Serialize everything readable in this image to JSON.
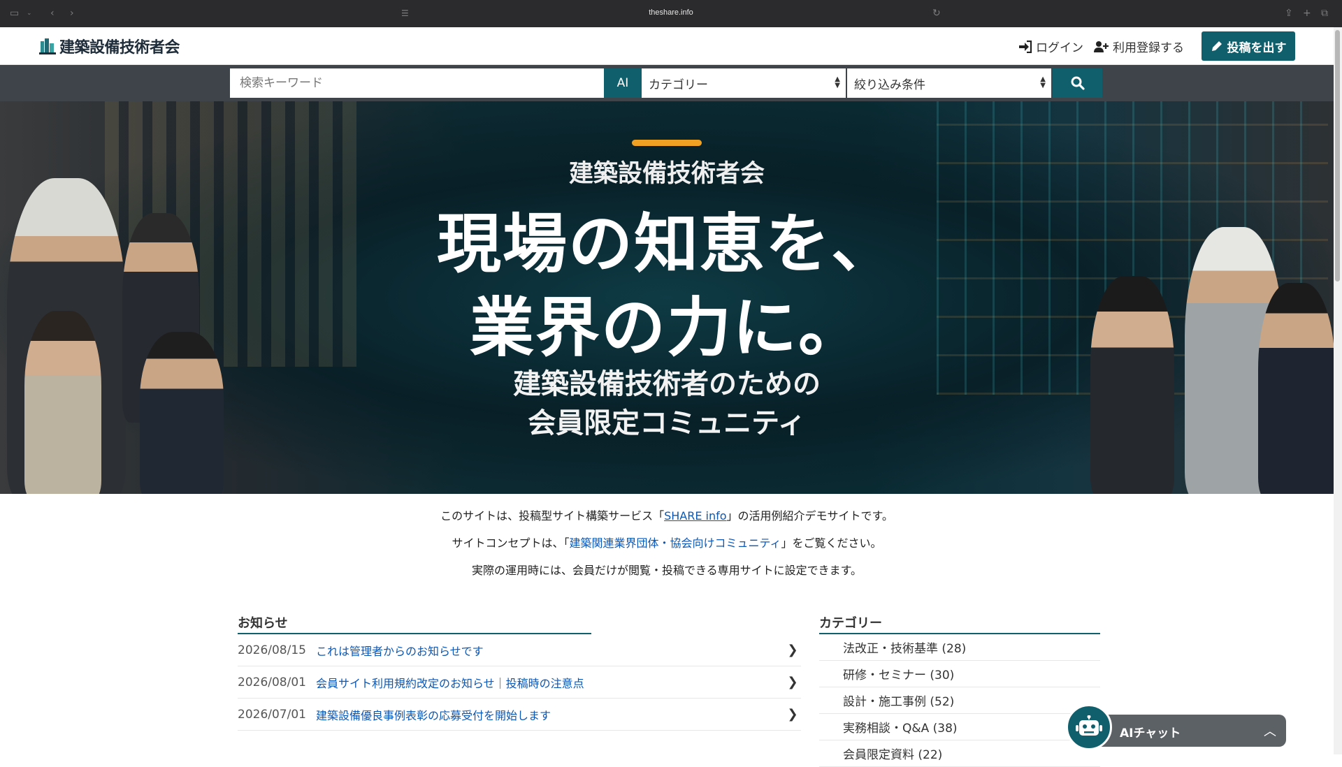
{
  "browser": {
    "url": "theshare.info"
  },
  "header": {
    "logo_text": "建築設備技術者会",
    "login_label": "ログイン",
    "register_label": "利用登録する",
    "post_label": "投稿を出す"
  },
  "search": {
    "keyword_placeholder": "検索キーワード",
    "ai_label": "AI",
    "category_selected": "カテゴリー",
    "filter_selected": "絞り込み条件"
  },
  "hero": {
    "org_name": "建築設備技術者会",
    "headline_line1": "現場の知恵を、",
    "headline_line2": "業界の力に。",
    "sub_line1": "建築設備技術者のための",
    "sub_line2": "会員限定コミュニティ"
  },
  "intro": {
    "line1_pre": "このサイトは、投稿型サイト構築サービス「",
    "line1_link": "SHARE info",
    "line1_post": "」の活用例紹介デモサイトです。",
    "line2_pre": "サイトコンセプトは、「",
    "line2_link": "建築関連業界団体・協会向けコミュニティ",
    "line2_post": "」をご覧ください。",
    "line3": "実際の運用時には、会員だけが閲覧・投稿できる専用サイトに設定できます。"
  },
  "news": {
    "title": "お知らせ",
    "items": [
      {
        "date": "2026/08/15",
        "title": "これは管理者からのお知らせです"
      },
      {
        "date": "2026/08/01",
        "title": "会員サイト利用規約改定のお知らせ｜投稿時の注意点"
      },
      {
        "date": "2026/07/01",
        "title": "建築設備優良事例表彰の応募受付を開始します"
      }
    ]
  },
  "categories": {
    "title": "カテゴリー",
    "items": [
      {
        "label": "法改正・技術基準 (28)"
      },
      {
        "label": "研修・セミナー (30)"
      },
      {
        "label": "設計・施工事例 (52)"
      },
      {
        "label": "実務相談・Q&A (38)"
      },
      {
        "label": "会員限定資料 (22)"
      }
    ]
  },
  "ai_chat": {
    "label": "AIチャット"
  },
  "colors": {
    "accent": "#0f5f6c",
    "link": "#0b57b5",
    "hero_accent": "#f0a022"
  }
}
